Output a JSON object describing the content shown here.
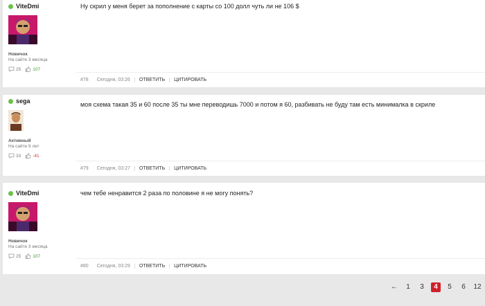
{
  "posts": [
    {
      "author": "ViteDmi",
      "rank": "Новичок",
      "since": "На сайте 3 месяца",
      "comments": "25",
      "rep": "107",
      "message": "Ну скрил у меня берет за пополнение с карты со 100 долл чуть ли не 106 $",
      "number": "#78",
      "date": "Сегодня, 03:26",
      "reply_label": "ОТВЕТИТЬ",
      "quote_label": "ЦИТИРОВАТЬ"
    },
    {
      "author": "sega",
      "rank": "Активный",
      "since": "На сайте 9 лет",
      "comments": "33",
      "rep": "-41",
      "message": "моя схема такая 35 и 60 после 35 ты мне переводишь 7000 и потом я 60, разбивать не буду там есть минималка в скриле",
      "number": "#79",
      "date": "Сегодня, 03:27",
      "reply_label": "ОТВЕТИТЬ",
      "quote_label": "ЦИТИРОВАТЬ"
    },
    {
      "author": "ViteDmi",
      "rank": "Новичок",
      "since": "На сайте 3 месяца",
      "comments": "25",
      "rep": "107",
      "message": "чем тебе ненравится 2 раза по половине я не могу понять?",
      "number": "#80",
      "date": "Сегодня, 03:29",
      "reply_label": "ОТВЕТИТЬ",
      "quote_label": "ЦИТИРОВАТЬ"
    }
  ],
  "pagination": {
    "prev": "←",
    "pages": [
      "1",
      "3",
      "4",
      "5",
      "6",
      "12"
    ],
    "current": "4"
  },
  "colors": {
    "online": "#6cc04a",
    "accent": "#d0202a",
    "rep_positive": "#3a9a2a",
    "rep_negative": "#d0312d"
  }
}
